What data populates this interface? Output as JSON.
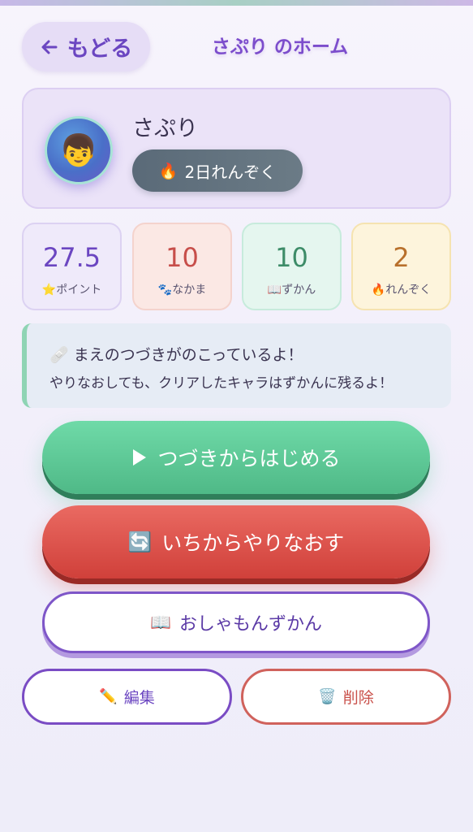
{
  "header": {
    "back_label": "もどる",
    "title": "さぷり のホーム"
  },
  "profile": {
    "avatar_emoji": "👦",
    "name": "さぷり",
    "streak_icon": "🔥",
    "streak_label": "2日れんぞく"
  },
  "stats": [
    {
      "value": "27.5",
      "icon": "⭐",
      "label": "ポイント"
    },
    {
      "value": "10",
      "icon": "🐾",
      "label": "なかま"
    },
    {
      "value": "10",
      "icon": "📖",
      "label": "ずかん"
    },
    {
      "value": "2",
      "icon": "🔥",
      "label": "れんぞく"
    }
  ],
  "notice": {
    "icon": "🩹",
    "line1": "まえのつづきがのこっているよ！",
    "line2": "やりなおしても、クリアしたキャラはずかんに残るよ！"
  },
  "actions": {
    "continue_label": "つづきからはじめる",
    "restart_icon": "🔄",
    "restart_label": "いちからやりなおす",
    "zukan_icon": "📖",
    "zukan_label": "おしゃもんずかん",
    "edit_icon": "✏️",
    "edit_label": "編集",
    "delete_icon": "🗑️",
    "delete_label": "削除"
  },
  "colors": {
    "accent": "#6b46c1",
    "continue": "#4fb987",
    "restart": "#d0403a"
  }
}
